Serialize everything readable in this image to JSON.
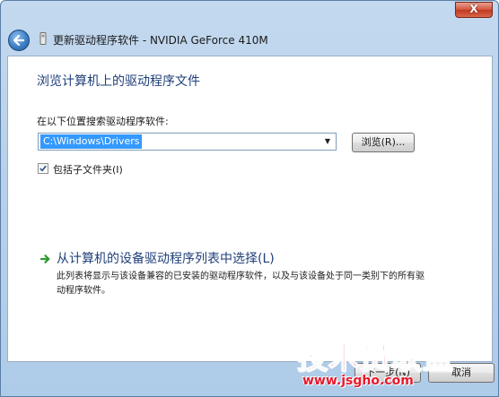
{
  "window": {
    "close_label": "X",
    "title": "更新驱动程序软件 - NVIDIA GeForce 410M"
  },
  "page": {
    "heading": "浏览计算机上的驱动程序文件",
    "search_label": "在以下位置搜索驱动程序软件:",
    "path_value": "C:\\Windows\\Drivers",
    "browse_label": "浏览(R)...",
    "include_subfolders_label": "包括子文件夹(I)",
    "include_subfolders_checked": true
  },
  "pick_link": {
    "title": "从计算机的设备驱动程序列表中选择(L)",
    "description": "此列表将显示与该设备兼容的已安装的驱动程序软件，以及与该设备处于同一类别下的所有驱动程序软件。"
  },
  "footer": {
    "next_label": "下一步(N)",
    "cancel_label": "取消"
  },
  "watermark": {
    "title": "技术员联盟",
    "url": "www.jsgho.com"
  },
  "icons": {
    "back": "back-arrow-icon",
    "title": "device-icon",
    "checkbox": "checkmark-icon",
    "link": "green-arrow-icon"
  },
  "colors": {
    "heading": "#1f3f7a",
    "selection": "#3399ff",
    "link_arrow": "#2e9b2e",
    "close_button": "#c0391f",
    "watermark": "#e8182b"
  }
}
